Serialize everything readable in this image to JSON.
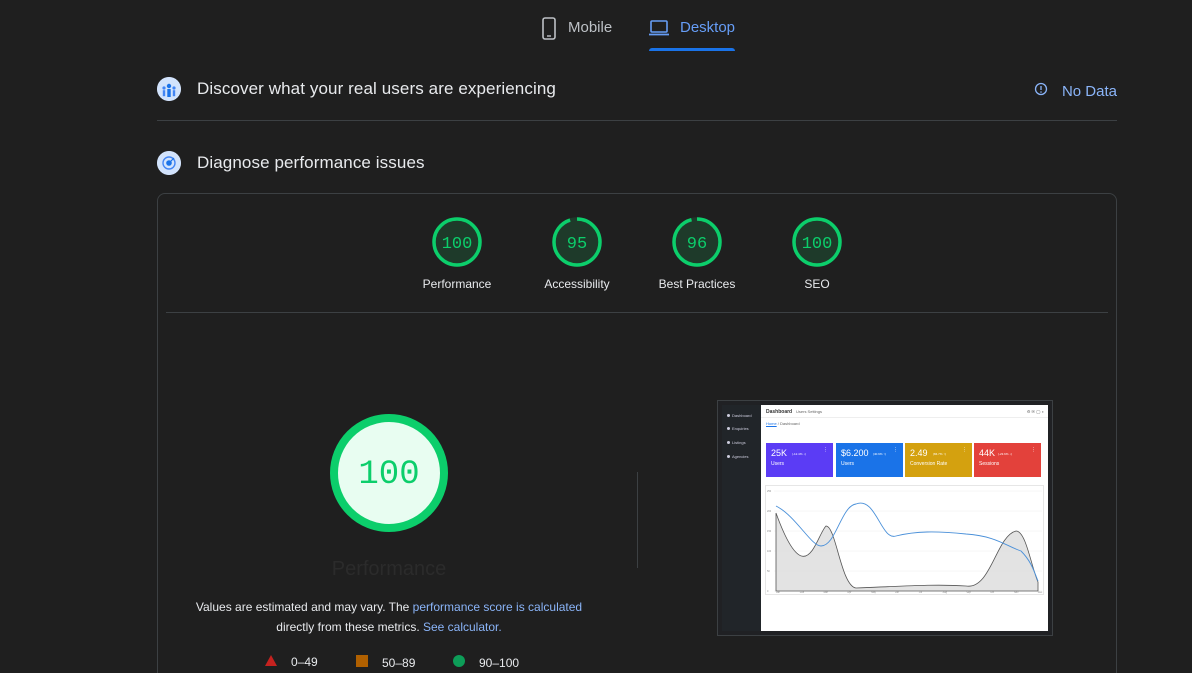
{
  "tabs": [
    {
      "label": "Mobile",
      "icon": "mobile-phone-icon",
      "active": false
    },
    {
      "label": "Desktop",
      "icon": "laptop-icon",
      "active": true
    }
  ],
  "field_data": {
    "title": "Discover what your real users are experiencing",
    "status": "No Data",
    "status_icon": "info-icon"
  },
  "lab": {
    "title": "Diagnose performance issues"
  },
  "scores": [
    {
      "value": 100,
      "display": "100",
      "label": "Performance"
    },
    {
      "value": 95,
      "display": "95",
      "label": "Accessibility"
    },
    {
      "value": 96,
      "display": "96",
      "label": "Best Practices"
    },
    {
      "value": 100,
      "display": "100",
      "label": "SEO"
    }
  ],
  "main_score": {
    "value": 100,
    "display": "100",
    "label": "Performance"
  },
  "estimate": {
    "text1": "Values are estimated and may vary. The ",
    "link1": "performance score is calculated",
    "text2": "directly from these metrics. ",
    "link2": "See calculator."
  },
  "legend": [
    {
      "range": "0–49",
      "shape": "triangle",
      "color": "#c5221f"
    },
    {
      "range": "50–89",
      "shape": "square",
      "color": "#b06000"
    },
    {
      "range": "90–100",
      "shape": "circle",
      "color": "#0d9d58"
    }
  ],
  "colors": {
    "pass": "#0cce6b",
    "pass_fill": "#e8fdf1",
    "accent": "#8ab4f8"
  },
  "screenshot": {
    "header": "Dashboard",
    "links": "Users   Settings",
    "breadcrumb_home": "Home",
    "breadcrumb_current": "Dashboard",
    "sidebar": [
      "Dashboard",
      "Enquiries",
      "Listings",
      "Agencies"
    ],
    "kpis": [
      {
        "value": "25K",
        "change": "(-12.4% ↓)",
        "label": "Users",
        "color": "#5b3cf5"
      },
      {
        "value": "$6.200",
        "change": "(40.9% ↑)",
        "label": "Users",
        "color": "#1a73e8"
      },
      {
        "value": "2.49",
        "change": "(84.7% ↑)",
        "label": "Conversion Rate",
        "color": "#d4a10f"
      },
      {
        "value": "44K",
        "change": "(-23.6% ↓)",
        "label": "Sessions",
        "color": "#e3413b"
      }
    ],
    "chart_months": [
      "Jan",
      "Feb",
      "Mar",
      "Apr",
      "May",
      "Jun",
      "Jul",
      "Aug",
      "Sep",
      "Oct",
      "Nov",
      "Dec"
    ],
    "chart_yticks": [
      "250",
      "200",
      "150",
      "100",
      "50",
      "0"
    ]
  }
}
